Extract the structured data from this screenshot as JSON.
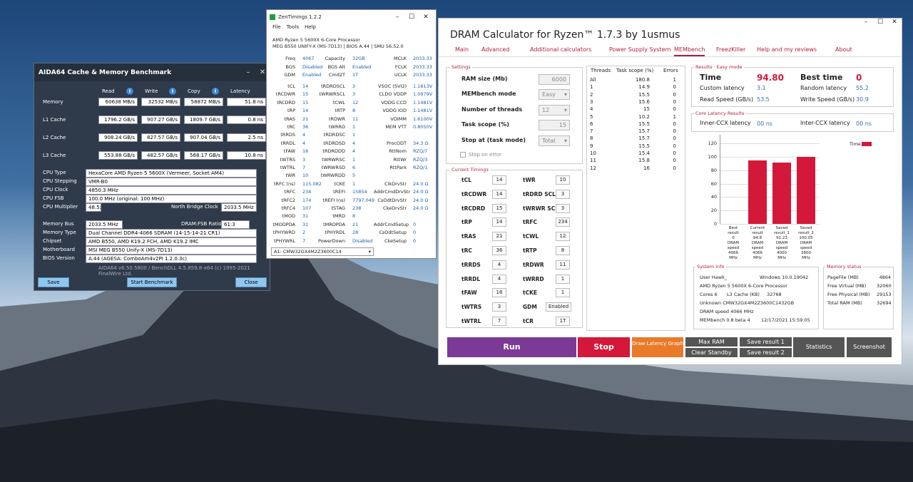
{
  "aida": {
    "title": "AIDA64 Cache & Memory Benchmark",
    "cols": [
      "Read",
      "Write",
      "Copy",
      "Latency"
    ],
    "rows": [
      {
        "label": "Memory",
        "read": "60638 MB/s",
        "write": "32532 MB/s",
        "copy": "58872 MB/s",
        "lat": "51.8 ns"
      },
      {
        "label": "L1 Cache",
        "read": "1796.2 GB/s",
        "write": "907.27 GB/s",
        "copy": "1809.7 GB/s",
        "lat": "0.8 ns"
      },
      {
        "label": "L2 Cache",
        "read": "908.24 GB/s",
        "write": "827.57 GB/s",
        "copy": "907.04 GB/s",
        "lat": "2.5 ns"
      },
      {
        "label": "L3 Cache",
        "read": "553.88 GB/s",
        "write": "482.57 GB/s",
        "copy": "568.17 GB/s",
        "lat": "10.8 ns"
      }
    ],
    "cpu_type_l": "CPU Type",
    "cpu_type": "HexaCore AMD Ryzen 5 5600X  (Vermeer, Socket AM4)",
    "cpu_step_l": "CPU Stepping",
    "cpu_step": "VMR-B0",
    "cpu_clock_l": "CPU Clock",
    "cpu_clock": "4850.3 MHz",
    "cpu_fsb_l": "CPU FSB",
    "cpu_fsb": "100.0 MHz  (original: 100 MHz)",
    "cpu_mult_l": "CPU Multiplier",
    "cpu_mult": "48.5x",
    "nb_l": "North Bridge Clock",
    "nb": "2033.5 MHz",
    "mbus_l": "Memory Bus",
    "mbus": "2033.5 MHz",
    "ratio_l": "DRAM:FSB Ratio",
    "ratio": "61:3",
    "mtype_l": "Memory Type",
    "mtype": "Dual Channel DDR4-4066 SDRAM  (14-15-14-21 CR1)",
    "chipset_l": "Chipset",
    "chipset": "AMD B550, AMD K19.2 FCH, AMD K19.2 IMC",
    "mobo_l": "Motherboard",
    "mobo": "MSI MEG B550 Unify-X (MS-7D13)",
    "bios_l": "BIOS Version",
    "bios": "A.44  (AGESA: ComboAm4v2PI 1.2.0.3c)",
    "footer": "AIDA64 v6.50.5800 / BenchDLL 4.5.859.8-x64  (c) 1995-2021 FinalWire Ltd.",
    "save": "Save",
    "start": "Start Benchmark",
    "close": "Close"
  },
  "zen": {
    "title": "ZenTimings 1.2.2",
    "menu": [
      "File",
      "Tools",
      "Help"
    ],
    "cpu": "AMD Ryzen 5 5600X 6-Core Processor",
    "board": "MEG B550 UNIFY-X (MS-7D13) | BIOS A.44 | SMU 56.52.0",
    "top": [
      [
        "Freq",
        "4067",
        "Capacity",
        "32GB",
        "MCLK",
        "2033.33"
      ],
      [
        "BGS",
        "Disabled",
        "BGS Alt",
        "Enabled",
        "FCLK",
        "2033.33"
      ],
      [
        "GDM",
        "Enabled",
        "Cmd2T",
        "1T",
        "UCLK",
        "2033.33"
      ]
    ],
    "rows": [
      [
        "tCL",
        "14",
        "tRDRDSCL",
        "3",
        "VSOC (SVI2)",
        "1.1813V"
      ],
      [
        "tRCDWR",
        "15",
        "tWRWRSCL",
        "3",
        "CLDO VDDP",
        "1.0979V"
      ],
      [
        "tRCDRD",
        "15",
        "tCWL",
        "12",
        "VDDG CCD",
        "1.1481V"
      ],
      [
        "tRP",
        "14",
        "tRTP",
        "8",
        "VDDG IOD",
        "1.1481V"
      ],
      [
        "tRAS",
        "21",
        "tRDWR",
        "11",
        "VDIMM",
        "1.6100V"
      ],
      [
        "tRC",
        "36",
        "tWRRD",
        "1",
        "MEM VTT",
        "0.8050V"
      ],
      [
        "tRRDS",
        "4",
        "tRDRDSC",
        "1",
        "",
        ""
      ],
      [
        "tRRDL",
        "4",
        "tRDRDSD",
        "4",
        "ProcODT",
        "34.3 Ω"
      ],
      [
        "tFAW",
        "16",
        "tRDRDDD",
        "4",
        "RttNom",
        "RZQ/7"
      ],
      [
        "tWTRS",
        "3",
        "tWRWRSC",
        "1",
        "RttWr",
        "RZQ/3"
      ],
      [
        "tWTRL",
        "7",
        "tWRWRSD",
        "6",
        "RttPark",
        "RZQ/1"
      ],
      [
        "tWR",
        "10",
        "tWRWRDD",
        "5",
        "",
        ""
      ],
      [
        "tRFC (ns)",
        "115.082",
        "tCKE",
        "1",
        "ClkDrvStr",
        "24.0 Ω"
      ],
      [
        "tRFC",
        "234",
        "tREFI",
        "15854",
        "AddrCmdDrvStr",
        "24.0 Ω"
      ],
      [
        "tRFC2",
        "174",
        "tREFI (ns)",
        "7797.049",
        "CsOdtDrvStr",
        "24.0 Ω"
      ],
      [
        "tRFC4",
        "107",
        "tSTAG",
        "238",
        "CkeDrvStr",
        "24.0 Ω"
      ],
      [
        "tMOD",
        "31",
        "tMRD",
        "8",
        "",
        ""
      ],
      [
        "tMODPDA",
        "31",
        "tMRDPDA",
        "21",
        "AddrCmdSetup",
        "0"
      ],
      [
        "tPHYWRD",
        "2",
        "tPHYRDL",
        "28",
        "CsOdtSetup",
        "0"
      ],
      [
        "tPHYWRL",
        "7",
        "PowerDown",
        "Disabled",
        "CkeSetup",
        "0"
      ]
    ],
    "dimm": "A1: CMW32GX4M2Z3600C14"
  },
  "dram": {
    "title": "DRAM Calculator for Ryzen™ 1.7.3 by 1usmus",
    "tabs": [
      "Main",
      "Advanced",
      "Additional calculators",
      "Power Supply System",
      "MEMbench",
      "FreezKiller",
      "Help and my reviews",
      "About"
    ],
    "settings_title": "Settings",
    "ram_size_l": "RAM size (Mb)",
    "ram_size": "6000",
    "mode_l": "MEMbench mode",
    "mode": "Easy",
    "threads_l": "Number of threads",
    "threads": "12",
    "scope_l": "Task scope (%)",
    "scope": "15",
    "stop_l": "Stop at (task mode)",
    "stop": "Total",
    "stop_err": "Stop on error",
    "timings_title": "Current Timings",
    "timings_left": [
      [
        "tCL",
        "14"
      ],
      [
        "tRCDWR",
        "14"
      ],
      [
        "tRCDRD",
        "15"
      ],
      [
        "tRP",
        "14"
      ],
      [
        "tRAS",
        "21"
      ],
      [
        "tRC",
        "36"
      ],
      [
        "tRRDS",
        "4"
      ],
      [
        "tRRDL",
        "4"
      ],
      [
        "tFAW",
        "16"
      ],
      [
        "tWTRS",
        "3"
      ],
      [
        "tWTRL",
        "7"
      ]
    ],
    "timings_right": [
      [
        "tWR",
        "10"
      ],
      [
        "tRDRD SCL",
        "3"
      ],
      [
        "tWRWR SCL",
        "3"
      ],
      [
        "tRFC",
        "234"
      ],
      [
        "tCWL",
        "12"
      ],
      [
        "tRTP",
        "8"
      ],
      [
        "tRDWR",
        "11"
      ],
      [
        "tWRRD",
        "1"
      ],
      [
        "tCKE",
        "1"
      ],
      [
        "GDM",
        "Enabled"
      ],
      [
        "tCR",
        "1T"
      ]
    ],
    "thr_hdr": [
      "Threads",
      "Task scope (%)",
      "Errors"
    ],
    "thr_rows": [
      [
        "All",
        "180.8",
        "1"
      ],
      [
        "1",
        "14.9",
        "0"
      ],
      [
        "2",
        "15.5",
        "0"
      ],
      [
        "3",
        "15.6",
        "0"
      ],
      [
        "4",
        "15",
        "0"
      ],
      [
        "5",
        "10.2",
        "1"
      ],
      [
        "6",
        "15.5",
        "0"
      ],
      [
        "7",
        "15.7",
        "0"
      ],
      [
        "8",
        "15.7",
        "0"
      ],
      [
        "9",
        "15.5",
        "0"
      ],
      [
        "10",
        "15.4",
        "0"
      ],
      [
        "11",
        "15.8",
        "0"
      ],
      [
        "12",
        "16",
        "0"
      ]
    ],
    "results_title": "Results · Easy mode",
    "time_l": "Time",
    "time": "94.80",
    "best_l": "Best time",
    "best": "0",
    "cust_l": "Custom latency",
    "cust": "3.1",
    "rand_l": "Random latency",
    "rand": "55.2",
    "read_l": "Read Speed (GB/s)",
    "read": "53.5",
    "write_l": "Write Speed (GB/s)",
    "write": "30.9",
    "core_title": "Core Latency Results",
    "inner_l": "Inner-CCX latency",
    "inner": "00 ns",
    "inter_l": "Inter-CCX latency",
    "inter": "00 ns",
    "sys_title": "System info",
    "sys": [
      "User Hawk_",
      "Windows 10.0.19042",
      "AMD Ryzen 5 5600X 6-Core Processor",
      "Cores 6",
      "L3 Cache (KB)",
      "32768",
      "Unknown CMW32GX4M2Z3600C1432GB",
      "DRAM speed 4066 MHz",
      "MEMbench 0.8 beta 4",
      "12/17/2021 15:59:05"
    ],
    "mem_title": "Memory status",
    "mem": [
      [
        "PageFile (MB)",
        "4864"
      ],
      [
        "Free Virtual (MB)",
        "32060"
      ],
      [
        "Free Physical (MB)",
        "29153"
      ],
      [
        "Total RAM (MB)",
        "32694"
      ]
    ],
    "btn": {
      "run": "Run",
      "stop": "Stop",
      "draw": "Draw Latency Graph",
      "maxram": "Max RAM",
      "clear": "Clear Standby",
      "save1": "Save result 1",
      "save2": "Save result 2",
      "stats": "Statistics",
      "shot": "Screenshot"
    },
    "colors": {
      "accent": "#d4183a",
      "run": "#7b3a96",
      "draw": "#e87a2a",
      "dark": "#555555"
    }
  },
  "chart_data": {
    "type": "bar",
    "legend": [
      "Time"
    ],
    "categories": [
      "Best result 0 DRAM speed 4066 MHz",
      "Current result 94.8 DRAM speed 4066 MHz",
      "Saved result_1 91.23 DRAM speed 4000 MHz",
      "Saved result_2 100.05 DRAM speed 3800 MHz"
    ],
    "values": [
      0,
      94.8,
      91.23,
      100.05
    ],
    "ylim": [
      0,
      120
    ],
    "yticks": [
      "0",
      "20",
      "40",
      "60",
      "80",
      "100",
      "120"
    ],
    "xlabels": [
      [
        "Best",
        "result",
        "0",
        "DRAM",
        "speed",
        "4066",
        "MHz"
      ],
      [
        "Current",
        "result",
        "94.8",
        "DRAM",
        "speed",
        "4066",
        "MHz"
      ],
      [
        "Saved",
        "result_1",
        "91.23",
        "DRAM",
        "speed",
        "4000",
        "MHz"
      ],
      [
        "Saved",
        "result_2",
        "100.05",
        "DRAM",
        "speed",
        "3800",
        "MHz"
      ]
    ]
  }
}
